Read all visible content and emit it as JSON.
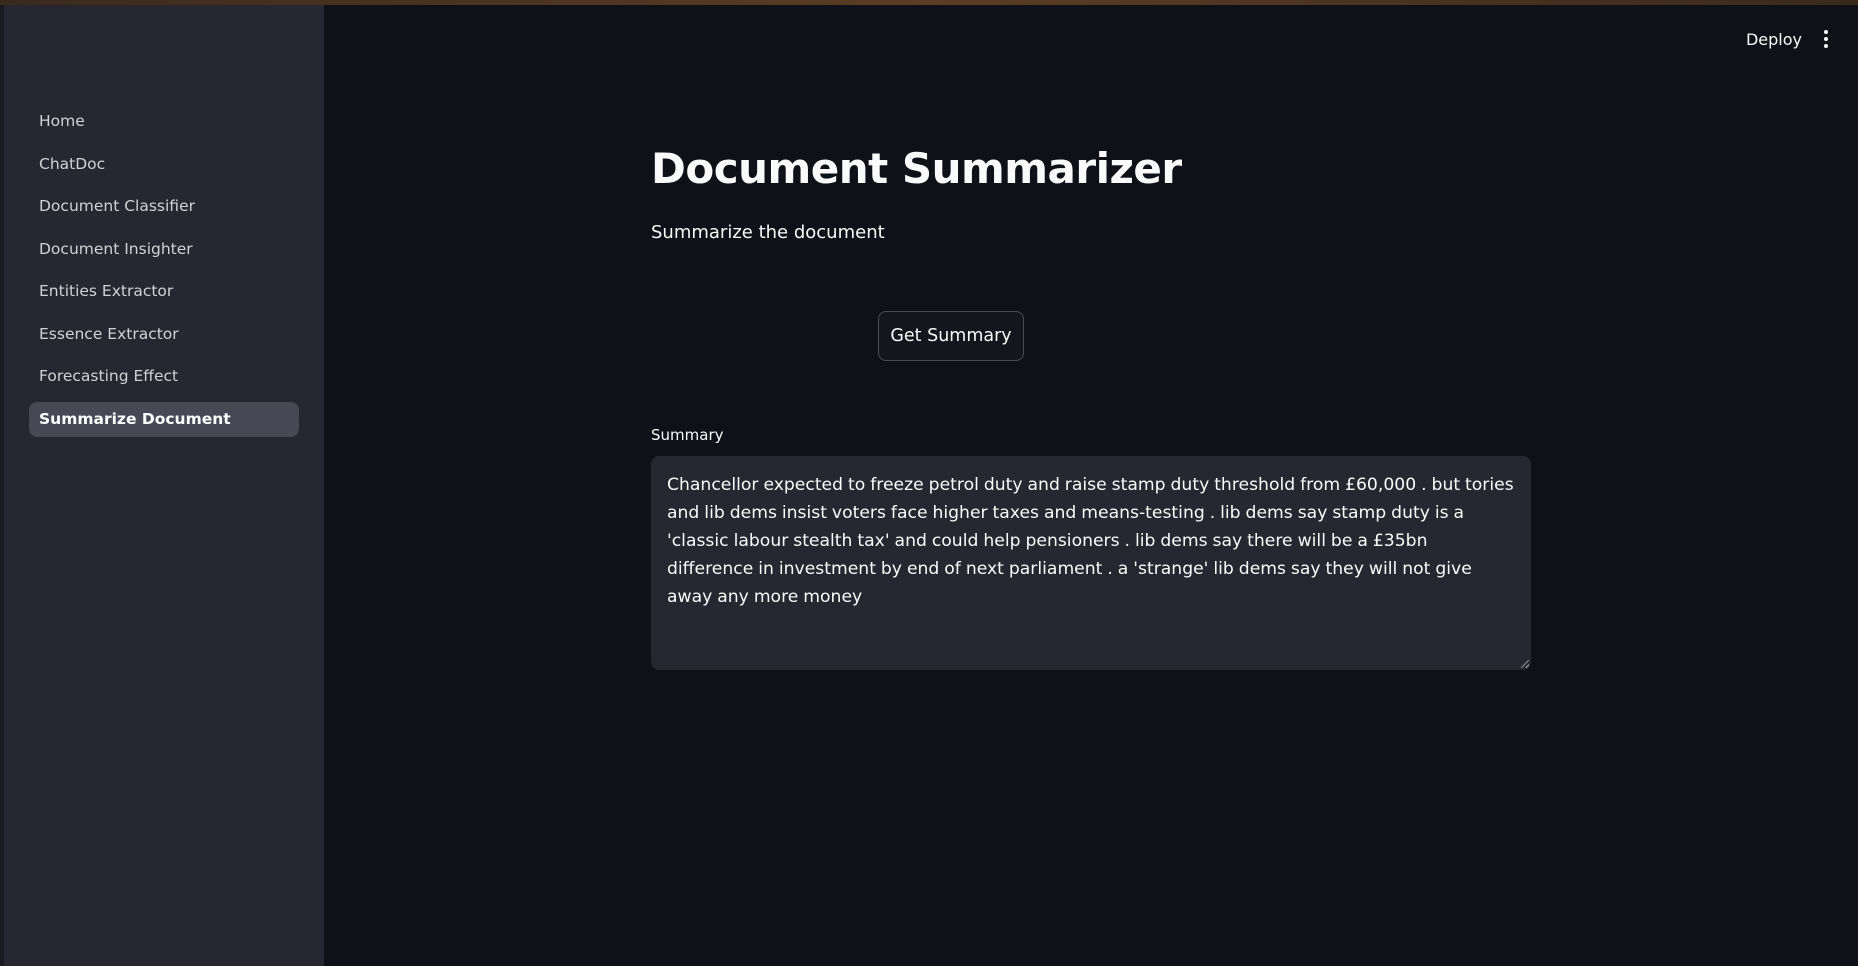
{
  "sidebar": {
    "items": [
      {
        "label": "Home",
        "active": false
      },
      {
        "label": "ChatDoc",
        "active": false
      },
      {
        "label": "Document Classifier",
        "active": false
      },
      {
        "label": "Document Insighter",
        "active": false
      },
      {
        "label": "Entities Extractor",
        "active": false
      },
      {
        "label": "Essence Extractor",
        "active": false
      },
      {
        "label": "Forecasting Effect",
        "active": false
      },
      {
        "label": "Summarize Document",
        "active": true
      }
    ]
  },
  "header": {
    "deploy_label": "Deploy",
    "menu_icon": "kebab-menu-icon"
  },
  "main": {
    "title": "Document Summarizer",
    "subtitle": "Summarize the document",
    "button_label": "Get Summary",
    "summary_label": "Summary",
    "summary_text": "Chancellor expected to freeze petrol duty and raise stamp duty threshold from £60,000 . but tories and lib dems insist voters face higher taxes and means-testing . lib dems say stamp duty is a 'classic labour stealth tax' and could help pensioners . lib dems say there will be a £35bn difference in investment by end of next parliament . a 'strange' lib dems say they will not give away any more money"
  },
  "colors": {
    "background": "#0e1117",
    "sidebar": "#262730",
    "active_item": "#464856",
    "text": "#fafafa"
  }
}
